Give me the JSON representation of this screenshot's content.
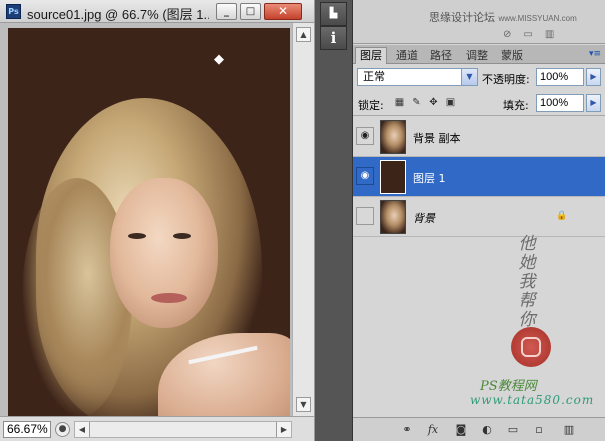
{
  "document_window": {
    "app_badge": "Ps",
    "title": "source01.jpg @ 66.7% (图层 1...",
    "zoom": "66.67%",
    "canvas_color": "#3c2419"
  },
  "dock": {
    "history_icon": "history-icon",
    "info_icon_label": "i"
  },
  "top_strip": {
    "watermark": "思缘设计论坛",
    "watermark_site": "www.MISSYUAN.com"
  },
  "layers_panel": {
    "tabs": [
      {
        "label": "图层",
        "active": true
      },
      {
        "label": "通道",
        "active": false
      },
      {
        "label": "路径",
        "active": false
      },
      {
        "label": "调整",
        "active": false
      },
      {
        "label": "蒙版",
        "active": false
      }
    ],
    "blend_mode": "正常",
    "opacity_label": "不透明度:",
    "opacity_value": "100%",
    "lock_label": "锁定:",
    "fill_label": "填充:",
    "fill_value": "100%",
    "layers": [
      {
        "name": "背景 副本",
        "visible": true,
        "selected": false,
        "thumb": "photo"
      },
      {
        "name": "图层 1",
        "visible": true,
        "selected": true,
        "thumb": "fill"
      },
      {
        "name": "背景",
        "visible": false,
        "selected": false,
        "thumb": "photo",
        "locked": true
      }
    ],
    "calligraphy": [
      "他",
      "她",
      "我",
      "帮",
      "你"
    ],
    "watermark_line": "PS教程网",
    "watermark_url": "www.tata580.com"
  },
  "colors": {
    "selection": "#3169c6",
    "panel_bg": "#d6d6d6",
    "close_button": "#c4422c"
  }
}
